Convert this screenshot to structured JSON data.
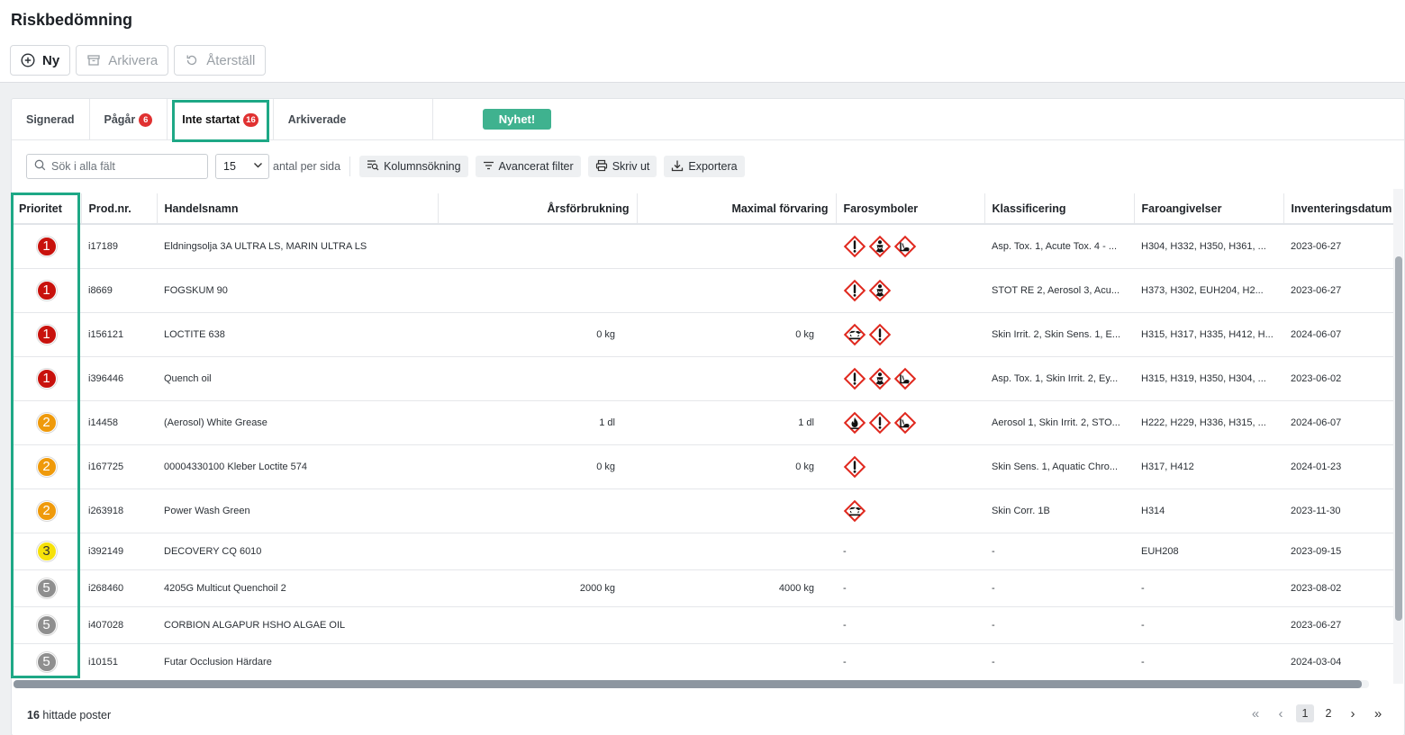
{
  "page": {
    "title": "Riskbedömning"
  },
  "toolbar": {
    "new_label": "Ny",
    "archive_label": "Arkivera",
    "restore_label": "Återställ"
  },
  "tabs": [
    {
      "label": "Signerad",
      "badge": ""
    },
    {
      "label": "Pågår",
      "badge": "6"
    },
    {
      "label": "Inte startat",
      "badge": "16"
    },
    {
      "label": "Arkiverade",
      "badge": ""
    }
  ],
  "news_badge": "Nyhet!",
  "filter": {
    "search_placeholder": "Sök i alla fält",
    "per_page_value": "15",
    "per_page_label": "antal per sida",
    "column_search": "Kolumnsökning",
    "advanced_filter": "Avancerat filter",
    "print": "Skriv ut",
    "export": "Exportera"
  },
  "columns": [
    "Prioritet",
    "Prod.nr.",
    "Handelsnamn",
    "Årsförbrukning",
    "Maximal förvaring",
    "Farosymboler",
    "Klassificering",
    "Faroangivelser",
    "Inventeringsdatum"
  ],
  "priority_colors": {
    "1": "#c8120d",
    "2": "#ef9a0b",
    "3": "#f6e10a",
    "5": "#8f8f8f"
  },
  "rows": [
    {
      "priority": "1",
      "prod": "i17189",
      "name": "Eldningsolja 3A ULTRA LS, MARIN ULTRA LS",
      "annual": "",
      "max": "",
      "symbols": [
        "exclamation-icon",
        "health-hazard-icon",
        "environment-icon"
      ],
      "classification": "Asp. Tox. 1, Acute Tox. 4 - ...",
      "hazards": "H304, H332, H350, H361, ...",
      "date": "2023-06-27"
    },
    {
      "priority": "1",
      "prod": "i8669",
      "name": "FOGSKUM 90",
      "annual": "",
      "max": "",
      "symbols": [
        "exclamation-icon",
        "health-hazard-icon"
      ],
      "classification": "STOT RE 2, Aerosol 3, Acu...",
      "hazards": "H373, H302, EUH204, H2...",
      "date": "2023-06-27"
    },
    {
      "priority": "1",
      "prod": "i156121",
      "name": "LOCTITE 638",
      "annual": "0 kg",
      "max": "0 kg",
      "symbols": [
        "corrosion-icon",
        "exclamation-icon"
      ],
      "classification": "Skin Irrit. 2, Skin Sens. 1, E...",
      "hazards": "H315, H317, H335, H412, H...",
      "date": "2024-06-07"
    },
    {
      "priority": "1",
      "prod": "i396446",
      "name": "Quench oil",
      "annual": "",
      "max": "",
      "symbols": [
        "exclamation-icon",
        "health-hazard-icon",
        "environment-icon"
      ],
      "classification": "Asp. Tox. 1, Skin Irrit. 2, Ey...",
      "hazards": "H315, H319, H350, H304, ...",
      "date": "2023-06-02"
    },
    {
      "priority": "2",
      "prod": "i14458",
      "name": "(Aerosol) White Grease",
      "annual": "1 dl",
      "max": "1 dl",
      "symbols": [
        "flame-icon",
        "exclamation-icon",
        "environment-icon"
      ],
      "classification": "Aerosol 1, Skin Irrit. 2, STO...",
      "hazards": "H222, H229, H336, H315, ...",
      "date": "2024-06-07"
    },
    {
      "priority": "2",
      "prod": "i167725",
      "name": "00004330100 Kleber Loctite 574",
      "annual": "0 kg",
      "max": "0 kg",
      "symbols": [
        "exclamation-icon"
      ],
      "classification": "Skin Sens. 1, Aquatic Chro...",
      "hazards": "H317, H412",
      "date": "2024-01-23"
    },
    {
      "priority": "2",
      "prod": "i263918",
      "name": "Power Wash Green",
      "annual": "",
      "max": "",
      "symbols": [
        "corrosion-icon"
      ],
      "classification": "Skin Corr. 1B",
      "hazards": "H314",
      "date": "2023-11-30"
    },
    {
      "priority": "3",
      "prod": "i392149",
      "name": "DECOVERY CQ 6010",
      "annual": "",
      "max": "",
      "symbols": [],
      "symbols_text": "-",
      "classification": "-",
      "hazards": "EUH208",
      "date": "2023-09-15"
    },
    {
      "priority": "5",
      "prod": "i268460",
      "name": "4205G Multicut Quenchoil 2",
      "annual": "2000 kg",
      "max": "4000 kg",
      "symbols": [],
      "symbols_text": "-",
      "classification": "-",
      "hazards": "-",
      "date": "2023-08-02"
    },
    {
      "priority": "5",
      "prod": "i407028",
      "name": "CORBION ALGAPUR HSHO ALGAE OIL",
      "annual": "",
      "max": "",
      "symbols": [],
      "symbols_text": "-",
      "classification": "-",
      "hazards": "-",
      "date": "2023-06-27"
    },
    {
      "priority": "5",
      "prod": "i10151",
      "name": "Futar Occlusion Härdare",
      "annual": "",
      "max": "",
      "symbols": [],
      "symbols_text": "-",
      "classification": "-",
      "hazards": "-",
      "date": "2024-03-04"
    }
  ],
  "footer": {
    "count": "16",
    "count_label": "hittade poster",
    "pages": [
      "1",
      "2"
    ],
    "current_page": "1"
  }
}
